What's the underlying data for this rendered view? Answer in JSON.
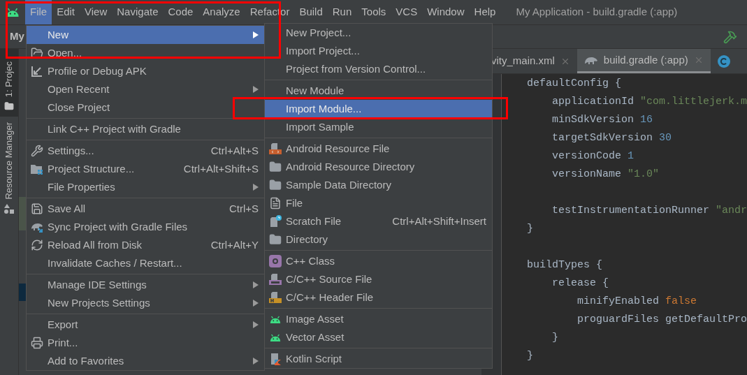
{
  "window": {
    "title": "My Application - build.gradle (:app)"
  },
  "menu_bar": [
    {
      "label": "File",
      "selected": true
    },
    {
      "label": "Edit",
      "selected": false
    },
    {
      "label": "View",
      "selected": false
    },
    {
      "label": "Navigate",
      "selected": false
    },
    {
      "label": "Code",
      "selected": false
    },
    {
      "label": "Analyze",
      "selected": false
    },
    {
      "label": "Refactor",
      "selected": false
    },
    {
      "label": "Build",
      "selected": false
    },
    {
      "label": "Run",
      "selected": false
    },
    {
      "label": "Tools",
      "selected": false
    },
    {
      "label": "VCS",
      "selected": false
    },
    {
      "label": "Window",
      "selected": false
    },
    {
      "label": "Help",
      "selected": false
    }
  ],
  "toolbar": {
    "project_name": "My"
  },
  "tool_strip": [
    {
      "label": "1: Projec",
      "selected": true
    },
    {
      "label": "Resource Manager",
      "selected": false
    }
  ],
  "file_menu": [
    [
      {
        "label": "New",
        "submenu": true,
        "selected": true
      },
      {
        "label": "Open...",
        "submenu": false,
        "selected": false
      },
      {
        "label": "Profile or Debug APK",
        "submenu": false,
        "selected": false
      },
      {
        "label": "Open Recent",
        "submenu": true,
        "selected": false
      },
      {
        "label": "Close Project",
        "submenu": false,
        "selected": false
      }
    ],
    [
      {
        "label": "Link C++ Project with Gradle",
        "submenu": false,
        "selected": false
      }
    ],
    [
      {
        "label": "Settings...",
        "shortcut": "Ctrl+Alt+S",
        "submenu": false,
        "selected": false
      },
      {
        "label": "Project Structure...",
        "shortcut": "Ctrl+Alt+Shift+S",
        "submenu": false,
        "selected": false
      },
      {
        "label": "File Properties",
        "submenu": true,
        "selected": false
      }
    ],
    [
      {
        "label": "Save All",
        "shortcut": "Ctrl+S",
        "submenu": false,
        "selected": false
      },
      {
        "label": "Sync Project with Gradle Files",
        "submenu": false,
        "selected": false
      },
      {
        "label": "Reload All from Disk",
        "shortcut": "Ctrl+Alt+Y",
        "submenu": false,
        "selected": false
      },
      {
        "label": "Invalidate Caches / Restart...",
        "submenu": false,
        "selected": false
      }
    ],
    [
      {
        "label": "Manage IDE Settings",
        "submenu": true,
        "selected": false
      },
      {
        "label": "New Projects Settings",
        "submenu": true,
        "selected": false
      }
    ],
    [
      {
        "label": "Export",
        "submenu": true,
        "selected": false
      },
      {
        "label": "Print...",
        "submenu": false,
        "selected": false
      },
      {
        "label": "Add to Favorites",
        "submenu": true,
        "selected": false
      }
    ]
  ],
  "new_submenu": [
    [
      {
        "label": "New Project...",
        "selected": false
      },
      {
        "label": "Import Project...",
        "selected": false
      },
      {
        "label": "Project from Version Control...",
        "selected": false
      }
    ],
    [
      {
        "label": "New Module",
        "selected": false
      },
      {
        "label": "Import Module...",
        "selected": true
      },
      {
        "label": "Import Sample",
        "selected": false
      }
    ],
    [
      {
        "label": "Android Resource File",
        "selected": false
      },
      {
        "label": "Android Resource Directory",
        "selected": false
      },
      {
        "label": "Sample Data Directory",
        "selected": false
      },
      {
        "label": "File",
        "selected": false
      },
      {
        "label": "Scratch File",
        "shortcut": "Ctrl+Alt+Shift+Insert",
        "selected": false
      },
      {
        "label": "Directory",
        "selected": false
      }
    ],
    [
      {
        "label": "C++ Class",
        "selected": false
      },
      {
        "label": "C/C++ Source File",
        "selected": false
      },
      {
        "label": "C/C++ Header File",
        "selected": false
      }
    ],
    [
      {
        "label": "Image Asset",
        "selected": false
      },
      {
        "label": "Vector Asset",
        "selected": false
      }
    ],
    [
      {
        "label": "Kotlin Script",
        "selected": false
      }
    ]
  ],
  "editor_tabs": [
    {
      "label": "vity_main.xml",
      "selected": false
    },
    {
      "label": "build.gradle (:app)",
      "selected": true
    },
    {
      "selected": false
    }
  ],
  "code_lines": [
    {
      "tokens": [
        {
          "kind": "plain",
          "text": "    defaultConfig {"
        }
      ]
    },
    {
      "tokens": [
        {
          "kind": "plain",
          "text": "        applicationId "
        },
        {
          "kind": "string",
          "text": "\"com.littlejerk.m"
        }
      ]
    },
    {
      "tokens": [
        {
          "kind": "plain",
          "text": "        minSdkVersion "
        },
        {
          "kind": "number",
          "text": "16"
        }
      ]
    },
    {
      "tokens": [
        {
          "kind": "plain",
          "text": "        targetSdkVersion "
        },
        {
          "kind": "number",
          "text": "30"
        }
      ]
    },
    {
      "tokens": [
        {
          "kind": "plain",
          "text": "        versionCode "
        },
        {
          "kind": "number",
          "text": "1"
        }
      ]
    },
    {
      "tokens": [
        {
          "kind": "plain",
          "text": "        versionName "
        },
        {
          "kind": "string",
          "text": "\"1.0\""
        }
      ]
    },
    {
      "kind": "blank"
    },
    {
      "tokens": [
        {
          "kind": "plain",
          "text": "        testInstrumentationRunner "
        },
        {
          "kind": "string",
          "text": "\"andr"
        }
      ]
    },
    {
      "tokens": [
        {
          "kind": "plain",
          "text": "    }"
        }
      ]
    },
    {
      "kind": "blank"
    },
    {
      "tokens": [
        {
          "kind": "plain",
          "text": "    buildTypes {"
        }
      ]
    },
    {
      "tokens": [
        {
          "kind": "plain",
          "text": "        release {"
        }
      ]
    },
    {
      "tokens": [
        {
          "kind": "plain",
          "text": "            minifyEnabled "
        },
        {
          "kind": "keyword",
          "text": "false"
        }
      ]
    },
    {
      "tokens": [
        {
          "kind": "plain",
          "text": "            proguardFiles getDefaultPro"
        }
      ]
    },
    {
      "tokens": [
        {
          "kind": "plain",
          "text": "        }"
        }
      ]
    },
    {
      "tokens": [
        {
          "kind": "plain",
          "text": "    }"
        }
      ]
    }
  ],
  "annotations": [
    {
      "kind": "frame"
    },
    {
      "kind": "frame"
    }
  ]
}
